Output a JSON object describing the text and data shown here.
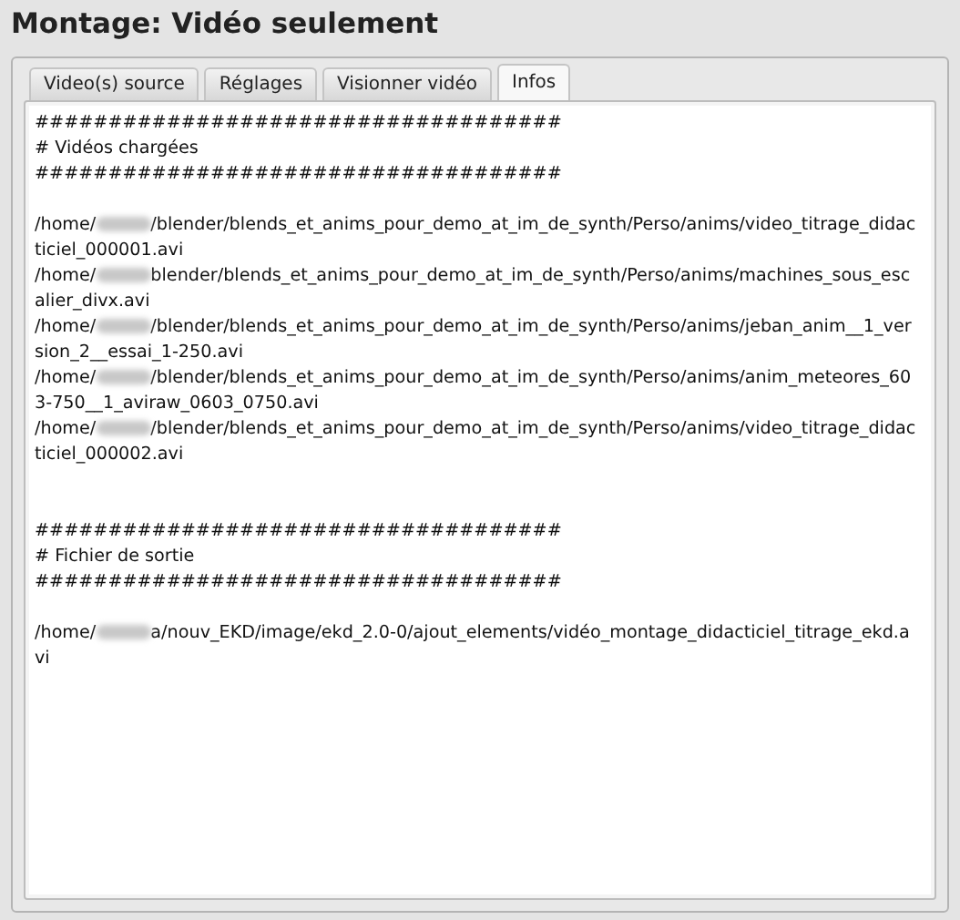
{
  "window": {
    "title": "Montage: Vidéo seulement"
  },
  "tabs": [
    {
      "label": "Video(s) source",
      "selected": false
    },
    {
      "label": "Réglages",
      "selected": false
    },
    {
      "label": "Visionner vidéo",
      "selected": false
    },
    {
      "label": "Infos",
      "selected": true
    }
  ],
  "infos": {
    "sections": [
      {
        "rule_top": "####################################",
        "heading": "# Vidéos chargées",
        "rule_bottom": "####################################",
        "paths": [
          {
            "start": "/home/",
            "end": "/blender/blends_et_anims_pour_demo_at_im_de_synth/Perso/anims/video_titrage_didac",
            "continuation": "ticiel_000001.avi"
          },
          {
            "start": "/home/",
            "end": "blender/blends_et_anims_pour_demo_at_im_de_synth/Perso/anims/machines_sous_esc",
            "continuation": "alier_divx.avi"
          },
          {
            "start": "/home/",
            "end": "/blender/blends_et_anims_pour_demo_at_im_de_synth/Perso/anims/jeban_anim__1_ver",
            "continuation": "sion_2__essai_1-250.avi"
          },
          {
            "start": "/home/",
            "end": "/blender/blends_et_anims_pour_demo_at_im_de_synth/Perso/anims/anim_meteores_60",
            "continuation": "3-750__1_aviraw_0603_0750.avi"
          },
          {
            "start": "/home/",
            "end": "/blender/blends_et_anims_pour_demo_at_im_de_synth/Perso/anims/video_titrage_didac",
            "continuation": "ticiel_000002.avi"
          }
        ]
      },
      {
        "rule_top": "####################################",
        "heading": "# Fichier de sortie",
        "rule_bottom": "####################################",
        "paths": [
          {
            "start": "/home/",
            "end": "a/nouv_EKD/image/ekd_2.0-0/ajout_elements/vidéo_montage_didacticiel_titrage_ekd.a",
            "continuation": "vi"
          }
        ]
      }
    ]
  }
}
